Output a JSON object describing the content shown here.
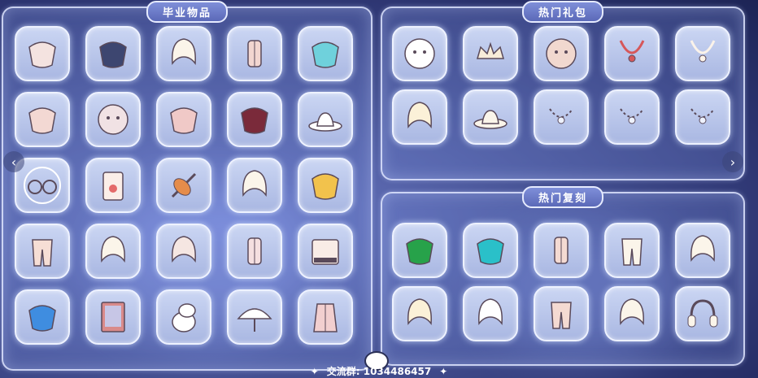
{
  "panels": {
    "graduation": {
      "title": "毕业物品"
    },
    "gifts": {
      "title": "热门礼包"
    },
    "reprints": {
      "title": "热门复刻"
    }
  },
  "footer": {
    "group_label": "交流群: 1034486457"
  },
  "items": {
    "graduation": [
      {
        "icon": "cape-icon",
        "color": "#f4e3e0"
      },
      {
        "icon": "dark-cape-icon",
        "color": "#3d4670"
      },
      {
        "icon": "hair-icon",
        "color": "#fbf5ea"
      },
      {
        "icon": "outfit-icon",
        "color": "#f2d6d0"
      },
      {
        "icon": "blue-cape-icon",
        "color": "#6fd1dc"
      },
      {
        "icon": "pink-cape-icon",
        "color": "#f3d8d3"
      },
      {
        "icon": "mask-icon",
        "color": "#f1e2e4"
      },
      {
        "icon": "shell-cape-icon",
        "color": "#f0c9c7"
      },
      {
        "icon": "red-cape-icon",
        "color": "#7a2a3a"
      },
      {
        "icon": "hat-icon",
        "color": "#ffffff"
      },
      {
        "icon": "glasses-icon",
        "color": "#ffffff"
      },
      {
        "icon": "card-icon",
        "color": "#fbeee8"
      },
      {
        "icon": "instrument-icon",
        "color": "#e58c4a"
      },
      {
        "icon": "ponytail-hair-icon",
        "color": "#fbf5ea"
      },
      {
        "icon": "gold-cape-icon",
        "color": "#f2c24c"
      },
      {
        "icon": "pants-icon",
        "color": "#f6ded5"
      },
      {
        "icon": "bun-hair-icon",
        "color": "#fbf5ea"
      },
      {
        "icon": "chair-icon",
        "color": "#f5e6e2"
      },
      {
        "icon": "rabbit-outfit-icon",
        "color": "#f5dfe0"
      },
      {
        "icon": "piano-icon",
        "color": "#f9ece6"
      },
      {
        "icon": "fishtail-cape-icon",
        "color": "#3f8de0"
      },
      {
        "icon": "poster-icon",
        "color": "#d98a8a"
      },
      {
        "icon": "moomin-icon",
        "color": "#ffffff"
      },
      {
        "icon": "umbrella-icon",
        "color": "#ffffff"
      },
      {
        "icon": "coat-icon",
        "color": "#f2cfcf"
      }
    ],
    "gifts": [
      {
        "icon": "mask-round-icon",
        "color": "#ffffff"
      },
      {
        "icon": "crown-icon",
        "color": "#f7ecd9"
      },
      {
        "icon": "hamster-mask-icon",
        "color": "#f1d8cf"
      },
      {
        "icon": "necklace-icon",
        "color": "#d6575a"
      },
      {
        "icon": "bow-necklace-icon",
        "color": "#fbf3ea"
      },
      {
        "icon": "curly-hair-icon",
        "color": "#fbf1d8"
      },
      {
        "icon": "witch-hat-icon",
        "color": "#fbf5ea"
      },
      {
        "icon": "scarf-icon",
        "color": "#eef2ff"
      },
      {
        "icon": "flower-scarf-icon",
        "color": "#eef2ff"
      },
      {
        "icon": "cat-scarf-icon",
        "color": "#eef2ff"
      }
    ],
    "reprints": [
      {
        "icon": "green-cape-icon",
        "color": "#27a24a"
      },
      {
        "icon": "teal-cape-icon",
        "color": "#2ac0c9"
      },
      {
        "icon": "jacket-outfit-icon",
        "color": "#f4dad2"
      },
      {
        "icon": "wide-pants-icon",
        "color": "#fbf5ea"
      },
      {
        "icon": "wavy-hair-icon",
        "color": "#fbf5ea"
      },
      {
        "icon": "bob-hair-icon",
        "color": "#fbf1d8"
      },
      {
        "icon": "cat-ear-hair-icon",
        "color": "#ffffff"
      },
      {
        "icon": "cargo-pants-icon",
        "color": "#f4dad2"
      },
      {
        "icon": "flower-crown-hair-icon",
        "color": "#fbf5ea"
      },
      {
        "icon": "earmuffs-icon",
        "color": "#fbf5ea"
      }
    ]
  }
}
